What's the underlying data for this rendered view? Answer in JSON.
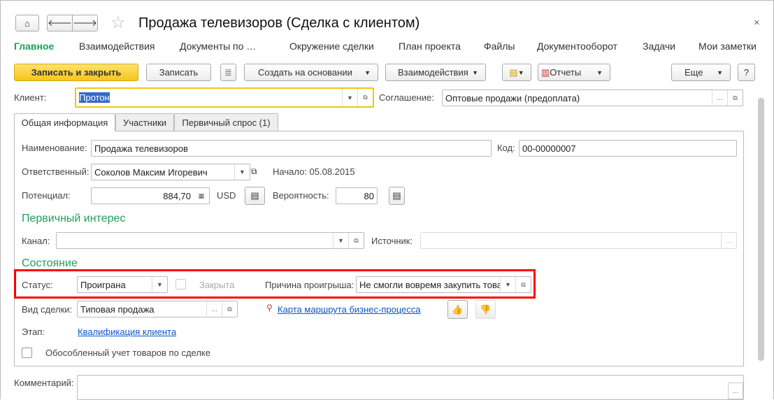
{
  "header": {
    "title": "Продажа телевизоров (Сделка с клиентом)",
    "close": "×"
  },
  "nav": [
    "Главное",
    "Взаимодействия",
    "Документы по …",
    "Окружение сделки",
    "План проекта",
    "Файлы",
    "Документооборот",
    "Задачи",
    "Мои заметки"
  ],
  "toolbar": {
    "save_close": "Записать и закрыть",
    "save": "Записать",
    "create_based": "Создать на основании",
    "interactions": "Взаимодействия",
    "reports": "Отчеты",
    "more": "Еще",
    "help": "?"
  },
  "client": {
    "label": "Клиент:",
    "value": "Протон"
  },
  "agreement": {
    "label": "Соглашение:",
    "value": "Оптовые продажи (предоплата)"
  },
  "tabs": [
    "Общая информация",
    "Участники",
    "Первичный спрос (1)"
  ],
  "general": {
    "name_label": "Наименование:",
    "name": "Продажа телевизоров",
    "code_label": "Код:",
    "code": "00-00000007",
    "resp_label": "Ответственный:",
    "resp": "Соколов Максим Игоревич",
    "start": "Начало: 05.08.2015",
    "potential_label": "Потенциал:",
    "potential": "884,70",
    "currency": "USD",
    "prob_label": "Вероятность:",
    "prob": "80"
  },
  "interest": {
    "title": "Первичный интерес",
    "channel_label": "Канал:",
    "channel": "",
    "source_label": "Источник:",
    "source": ""
  },
  "state": {
    "title": "Состояние",
    "status_label": "Статус:",
    "status": "Проиграна",
    "closed_label": "Закрыта",
    "reason_label": "Причина проигрыша:",
    "reason": "Не смогли вовремя закупить товар",
    "deal_type_label": "Вид сделки:",
    "deal_type": "Типовая продажа",
    "route_map": "Карта маршрута бизнес-процесса",
    "stage_label": "Этап:",
    "stage": "Квалификация клиента",
    "separate_label": "Обособленный учет товаров по сделке"
  },
  "comment": {
    "label": "Комментарий:",
    "value": ""
  }
}
